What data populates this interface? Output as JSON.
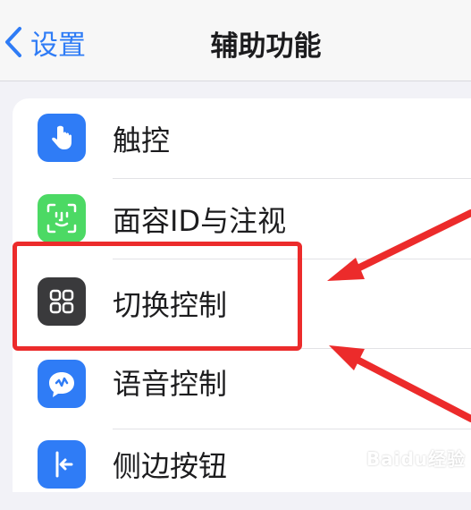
{
  "nav": {
    "back_label": "设置",
    "title": "辅助功能"
  },
  "items": [
    {
      "label": "触控",
      "icon": "hand-tap-icon",
      "color": "#2f7cf6"
    },
    {
      "label": "面容ID与注视",
      "icon": "face-id-icon",
      "color": "#4cd964"
    },
    {
      "label": "切换控制",
      "icon": "grid-icon",
      "color": "#3a3a3c"
    },
    {
      "label": "语音控制",
      "icon": "voice-control-icon",
      "color": "#2f7cf6"
    },
    {
      "label": "侧边按钮",
      "icon": "side-button-icon",
      "color": "#2f7cf6"
    }
  ],
  "annotation": {
    "highlight_color": "#ec2b2b"
  },
  "watermark": "Baidu经验"
}
